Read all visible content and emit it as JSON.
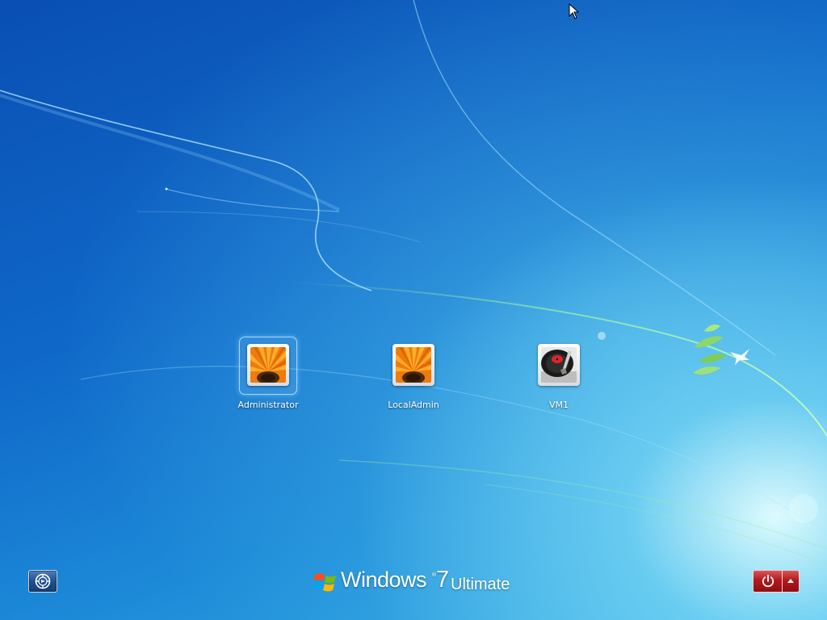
{
  "screen": {
    "title": "Windows 7 logon screen"
  },
  "users": [
    {
      "name": "Administrator",
      "picture": "orange-flower-picture",
      "selected": true
    },
    {
      "name": "LocalAdmin",
      "picture": "orange-flower-picture",
      "selected": false
    },
    {
      "name": "VM1",
      "picture": "turntable-picture",
      "selected": false
    }
  ],
  "branding": {
    "word": "Windows",
    "trademark": "®",
    "version": "7",
    "edition": "Ultimate"
  },
  "buttons": {
    "ease_of_access": "ease-of-access-icon",
    "shut_down": "power-icon",
    "shut_down_options": "chevron-up-icon"
  },
  "colors": {
    "power_button": "#b3191d",
    "background_dark": "#0a4fb3",
    "background_light": "#3bb2e6"
  }
}
